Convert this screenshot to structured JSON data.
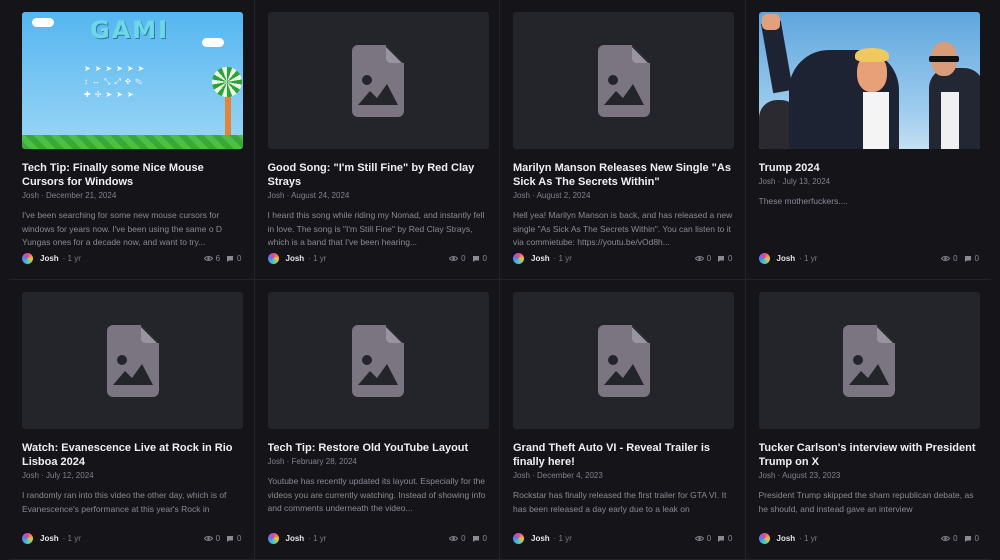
{
  "cards": [
    {
      "title": "Tech Tip: Finally some Nice Mouse Cursors for Windows",
      "meta": "Josh · December 21, 2024",
      "excerpt": "I've been searching for some new mouse cursors for windows for years now. I've been using the same o  D Yungas ones for a decade now, and want to try...",
      "author": "Josh",
      "age": "· 1 yr",
      "views": "6",
      "comments": "0",
      "thumb": "game",
      "logo_text": "GAMI"
    },
    {
      "title": "Good Song: \"I'm Still Fine\" by Red Clay Strays",
      "meta": "Josh · August 24, 2024",
      "excerpt": "I heard this song while riding my Nomad, and instantly fell in love. The song is \"I'm Still Fine\" by Red Clay Strays, which is a band that I've been hearing...",
      "author": "Josh",
      "age": "· 1 yr",
      "views": "0",
      "comments": "0",
      "thumb": "placeholder"
    },
    {
      "title": "Marilyn Manson Releases New Single \"As Sick As The Secrets Within\"",
      "meta": "Josh · August 2, 2024",
      "excerpt": "Hell yea! Marilyn Manson is back, and has released a new single \"As Sick As The Secrets Within\". You can listen to it via commietube: https://youtu.be/vOd8h...",
      "author": "Josh",
      "age": "· 1 yr",
      "views": "0",
      "comments": "0",
      "thumb": "placeholder"
    },
    {
      "title": "Trump 2024",
      "meta": "Josh · July 13, 2024",
      "excerpt": "These motherfuckers....",
      "author": "Josh",
      "age": "· 1 yr",
      "views": "0",
      "comments": "0",
      "thumb": "photo"
    },
    {
      "title": "Watch: Evanescence Live at Rock in Rio Lisboa 2024",
      "meta": "Josh · July 12, 2024",
      "excerpt": "I randomly ran into this video the other day, which is of Evanescence's performance at this year's Rock in",
      "author": "Josh",
      "age": "· 1 yr",
      "views": "0",
      "comments": "0",
      "thumb": "placeholder"
    },
    {
      "title": "Tech Tip: Restore Old YouTube Layout",
      "meta": "Josh · February 28, 2024",
      "excerpt": "Youtube has recently updated its layout. Especially for the videos you are currently watching. Instead of showing info and comments underneath the video...",
      "author": "Josh",
      "age": "· 1 yr",
      "views": "0",
      "comments": "0",
      "thumb": "placeholder"
    },
    {
      "title": "Grand Theft Auto VI - Reveal Trailer is finally here!",
      "meta": "Josh · December 4, 2023",
      "excerpt": "Rockstar has finally released the first trailer for GTA VI.  It has been released a day early due to a leak on",
      "author": "Josh",
      "age": "· 1 yr",
      "views": "0",
      "comments": "0",
      "thumb": "placeholder"
    },
    {
      "title": "Tucker Carlson's interview with President Trump on X",
      "meta": "Josh · August 23, 2023",
      "excerpt": "President Trump skipped the sham republican debate, as he should, and instead gave an interview",
      "author": "Josh",
      "age": "· 1 yr",
      "views": "0",
      "comments": "0",
      "thumb": "placeholder"
    }
  ],
  "icons": {
    "placeholder": "image-file-icon",
    "views": "eye-icon",
    "comments": "comment-icon"
  },
  "colors": {
    "background": "#141419",
    "card_thumb": "#24242b",
    "placeholder_icon": "#7a7580"
  }
}
